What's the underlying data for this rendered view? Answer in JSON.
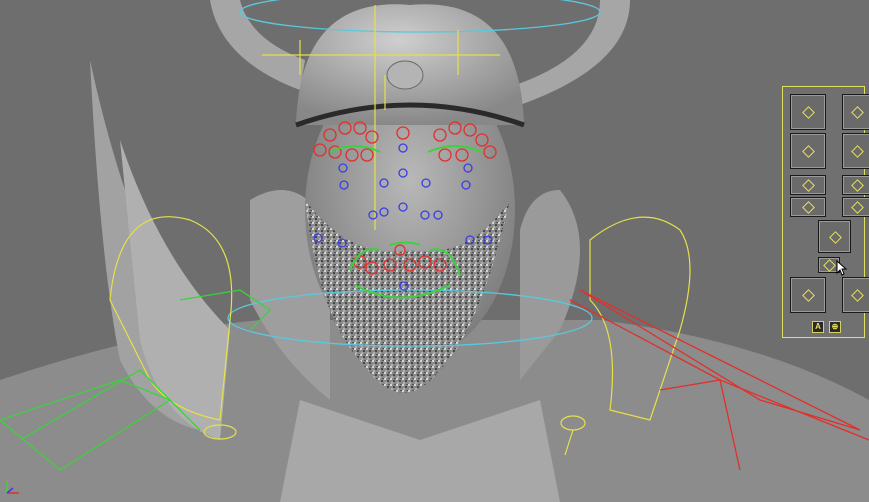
{
  "viewport": {
    "description_label": "",
    "panel": {
      "rows": [
        [
          "control",
          "control"
        ],
        [
          "control",
          "control"
        ],
        [
          "control",
          "control"
        ],
        [
          "control"
        ],
        [
          "control",
          "control"
        ]
      ],
      "button_a_label": "A",
      "button_b_icon": "pin-icon"
    }
  },
  "colors": {
    "viewport_bg": "#6e6e6e",
    "panel_border": "#e0e060",
    "control_yellow": "#e6e04a",
    "control_red": "#e0302c",
    "control_green": "#3cd23c",
    "control_blue": "#3c3ce6",
    "control_cyan": "#5ac8dc"
  },
  "icons": {
    "axis": "axis-gizmo-icon",
    "cursor": "mouse-cursor-icon"
  }
}
